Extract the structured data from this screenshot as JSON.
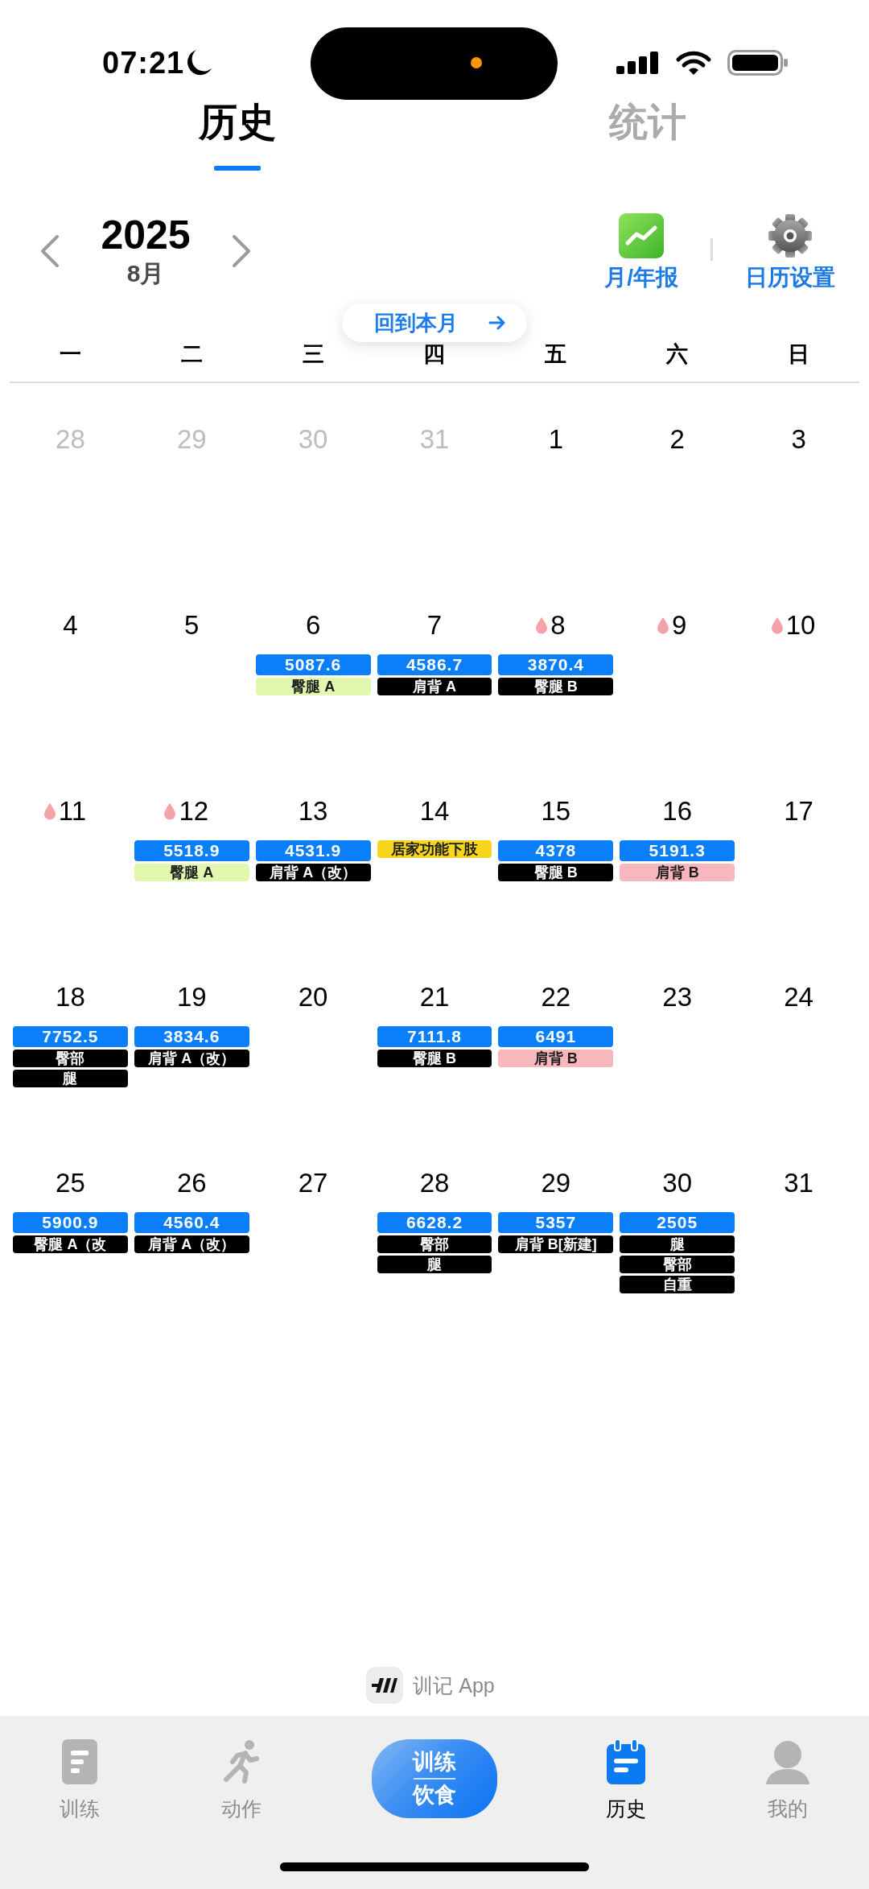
{
  "status_bar": {
    "time": "07:21"
  },
  "tabs": [
    {
      "label": "历史",
      "selected": true
    },
    {
      "label": "统计",
      "selected": false
    }
  ],
  "month_nav": {
    "year": "2025",
    "month": "8月"
  },
  "actions": [
    {
      "kind": "report",
      "label": "月/年报"
    },
    {
      "kind": "settings",
      "label": "日历设置"
    }
  ],
  "back_button": {
    "label": "回到本月"
  },
  "weekdays": [
    "一",
    "二",
    "三",
    "四",
    "五",
    "六",
    "日"
  ],
  "days": [
    {
      "day": "28",
      "in_month": false,
      "period": false
    },
    {
      "day": "29",
      "in_month": false,
      "period": false
    },
    {
      "day": "30",
      "in_month": false,
      "period": false
    },
    {
      "day": "31",
      "in_month": false,
      "period": false
    },
    {
      "day": "1",
      "in_month": true,
      "period": false
    },
    {
      "day": "2",
      "in_month": true,
      "period": false
    },
    {
      "day": "3",
      "in_month": true,
      "period": false
    },
    {
      "day": "4",
      "in_month": true,
      "period": false
    },
    {
      "day": "5",
      "in_month": true,
      "period": false
    },
    {
      "day": "6",
      "in_month": true,
      "period": false,
      "volume": "5087.6",
      "tags": [
        {
          "label": "臀腿 A",
          "color": "#e2f8ae"
        }
      ]
    },
    {
      "day": "7",
      "in_month": true,
      "period": false,
      "volume": "4586.7",
      "tags": [
        {
          "label": "肩背 A",
          "color": "#000000"
        }
      ]
    },
    {
      "day": "8",
      "in_month": true,
      "period": true,
      "volume": "3870.4",
      "tags": [
        {
          "label": "臀腿 B",
          "color": "#000000"
        }
      ]
    },
    {
      "day": "9",
      "in_month": true,
      "period": true
    },
    {
      "day": "10",
      "in_month": true,
      "period": true
    },
    {
      "day": "11",
      "in_month": true,
      "period": true
    },
    {
      "day": "12",
      "in_month": true,
      "period": true,
      "volume": "5518.9",
      "tags": [
        {
          "label": "臀腿 A",
          "color": "#e2f8ae"
        }
      ]
    },
    {
      "day": "13",
      "in_month": true,
      "period": false,
      "volume": "4531.9",
      "tags": [
        {
          "label": "肩背 A（改）",
          "color": "#000000"
        }
      ]
    },
    {
      "day": "14",
      "in_month": true,
      "period": false,
      "tags": [
        {
          "label": "居家功能下肢",
          "color": "#f7d51d"
        }
      ]
    },
    {
      "day": "15",
      "in_month": true,
      "period": false,
      "volume": "4378",
      "tags": [
        {
          "label": "臀腿 B",
          "color": "#000000"
        }
      ]
    },
    {
      "day": "16",
      "in_month": true,
      "period": false,
      "volume": "5191.3",
      "tags": [
        {
          "label": "肩背 B",
          "color": "#f8b6bd"
        }
      ]
    },
    {
      "day": "17",
      "in_month": true,
      "period": false
    },
    {
      "day": "18",
      "in_month": true,
      "period": false,
      "volume": "7752.5",
      "tags": [
        {
          "label": "臀部",
          "color": "#000000"
        },
        {
          "label": "腿",
          "color": "#000000"
        }
      ]
    },
    {
      "day": "19",
      "in_month": true,
      "period": false,
      "volume": "3834.6",
      "tags": [
        {
          "label": "肩背 A（改）",
          "color": "#000000"
        }
      ]
    },
    {
      "day": "20",
      "in_month": true,
      "period": false
    },
    {
      "day": "21",
      "in_month": true,
      "period": false,
      "volume": "7111.8",
      "tags": [
        {
          "label": "臀腿 B",
          "color": "#000000"
        }
      ]
    },
    {
      "day": "22",
      "in_month": true,
      "period": false,
      "volume": "6491",
      "tags": [
        {
          "label": "肩背 B",
          "color": "#f8b6bd"
        }
      ]
    },
    {
      "day": "23",
      "in_month": true,
      "period": false
    },
    {
      "day": "24",
      "in_month": true,
      "period": false
    },
    {
      "day": "25",
      "in_month": true,
      "period": false,
      "volume": "5900.9",
      "tags": [
        {
          "label": "臀腿 A（改",
          "color": "#000000"
        }
      ]
    },
    {
      "day": "26",
      "in_month": true,
      "period": false,
      "volume": "4560.4",
      "tags": [
        {
          "label": "肩背 A（改）",
          "color": "#000000"
        }
      ]
    },
    {
      "day": "27",
      "in_month": true,
      "period": false
    },
    {
      "day": "28",
      "in_month": true,
      "period": false,
      "volume": "6628.2",
      "tags": [
        {
          "label": "臀部",
          "color": "#000000"
        },
        {
          "label": "腿",
          "color": "#000000"
        }
      ]
    },
    {
      "day": "29",
      "in_month": true,
      "period": false,
      "volume": "5357",
      "tags": [
        {
          "label": "肩背 B[新建]",
          "color": "#000000"
        }
      ]
    },
    {
      "day": "30",
      "in_month": true,
      "period": false,
      "volume": "2505",
      "tags": [
        {
          "label": "腿",
          "color": "#000000"
        },
        {
          "label": "臀部",
          "color": "#000000"
        },
        {
          "label": "自重",
          "color": "#000000"
        }
      ]
    },
    {
      "day": "31",
      "in_month": true,
      "period": false
    }
  ],
  "footer": {
    "label": "训记 App"
  },
  "tab_bar": {
    "items": [
      {
        "kind": "log",
        "label": "训练",
        "selected": false
      },
      {
        "kind": "exercise",
        "label": "动作",
        "selected": false
      },
      {
        "kind": "history",
        "label": "历史",
        "selected": true
      },
      {
        "kind": "profile",
        "label": "我的",
        "selected": false
      }
    ],
    "center_button": {
      "lines": [
        "训练",
        "饮食"
      ]
    }
  }
}
